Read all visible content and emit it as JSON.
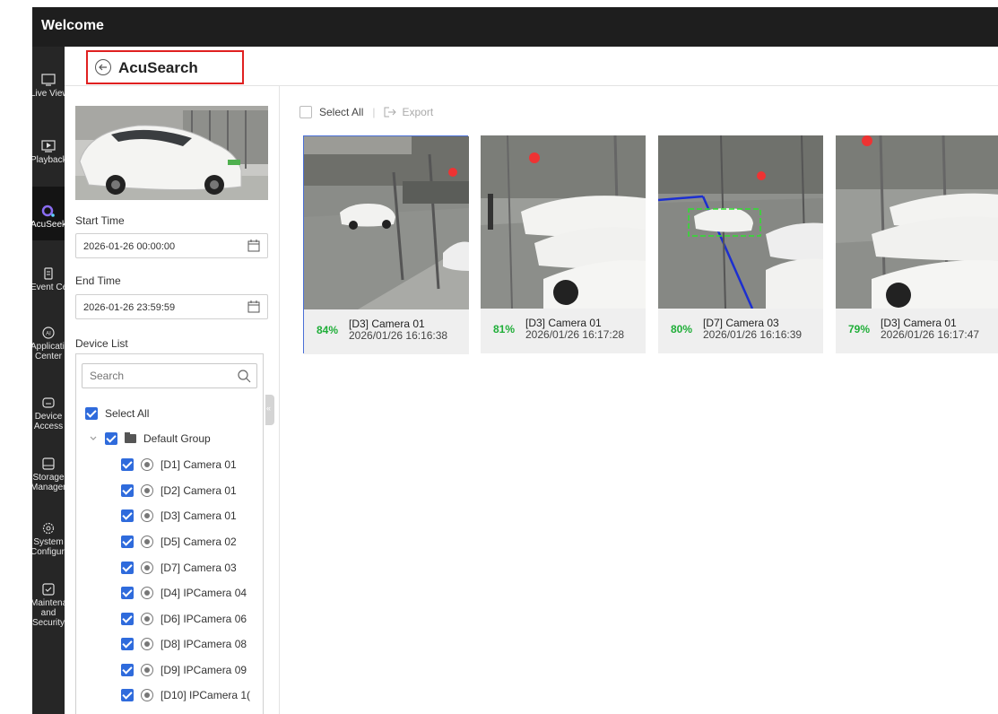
{
  "app": {
    "title": "Welcome"
  },
  "nav": [
    {
      "label": "Live View",
      "icon": "monitor-icon"
    },
    {
      "label": "Playback",
      "icon": "playback-icon"
    },
    {
      "label": "AcuSeek",
      "icon": "acuseek-icon",
      "active": true
    },
    {
      "label": "Event Center",
      "icon": "clipboard-icon"
    },
    {
      "label": "Application Center",
      "icon": "ai-icon"
    },
    {
      "label": "Device Access",
      "icon": "nvr-icon"
    },
    {
      "label": "Storage Management",
      "icon": "storage-icon"
    },
    {
      "label": "System Configuration",
      "icon": "gear-icon"
    },
    {
      "label": "Maintenance and Security",
      "icon": "shield-icon"
    }
  ],
  "header": {
    "title": "AcuSearch"
  },
  "filter": {
    "start_label": "Start Time",
    "start_value": "2026-01-26 00:00:00",
    "end_label": "End Time",
    "end_value": "2026-01-26 23:59:59",
    "device_list_label": "Device List",
    "search_placeholder": "Search",
    "select_all": "Select All",
    "group": "Default Group",
    "devices": [
      "[D1] Camera 01",
      "[D2] Camera 01",
      "[D3] Camera 01",
      "[D5] Camera 02",
      "[D7] Camera 03",
      "[D4] IPCamera 04",
      "[D6] IPCamera 06",
      "[D8] IPCamera 08",
      "[D9] IPCamera 09",
      "[D10] IPCamera 1("
    ]
  },
  "toolbar": {
    "select_all": "Select All",
    "separator": "|",
    "export": "Export"
  },
  "results": [
    {
      "similarity": "84%",
      "camera": "[D3] Camera 01",
      "time": "2026/01/26 16:16:38",
      "selected": true
    },
    {
      "similarity": "81%",
      "camera": "[D3] Camera 01",
      "time": "2026/01/26 16:17:28"
    },
    {
      "similarity": "80%",
      "camera": "[D7] Camera 03",
      "time": "2026/01/26 16:16:39"
    },
    {
      "similarity": "79%",
      "camera": "[D3] Camera 01",
      "time": "2026/01/26 16:17:47"
    }
  ],
  "colors": {
    "accent": "#2f6bdc",
    "similarity": "#1fae38",
    "highlight_border": "#e02020",
    "topbar": "#1e1e1e",
    "sidebar": "#262626"
  }
}
